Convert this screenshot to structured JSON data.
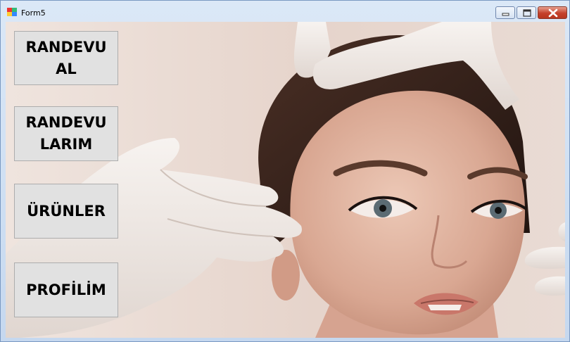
{
  "window": {
    "title": "Form5"
  },
  "buttons": [
    {
      "label": "RANDEVU AL"
    },
    {
      "label": "RANDEVU LARIM"
    },
    {
      "label": "ÜRÜNLER"
    },
    {
      "label": "PROFİLİM"
    }
  ],
  "icons": {
    "app": "form-icon",
    "minimize": "minimize-icon",
    "maximize": "maximize-icon",
    "close": "close-icon"
  },
  "colors": {
    "button_bg": "#e1e1e1",
    "close_red": "#c4412b",
    "title_bar": "#dbe8f7"
  }
}
